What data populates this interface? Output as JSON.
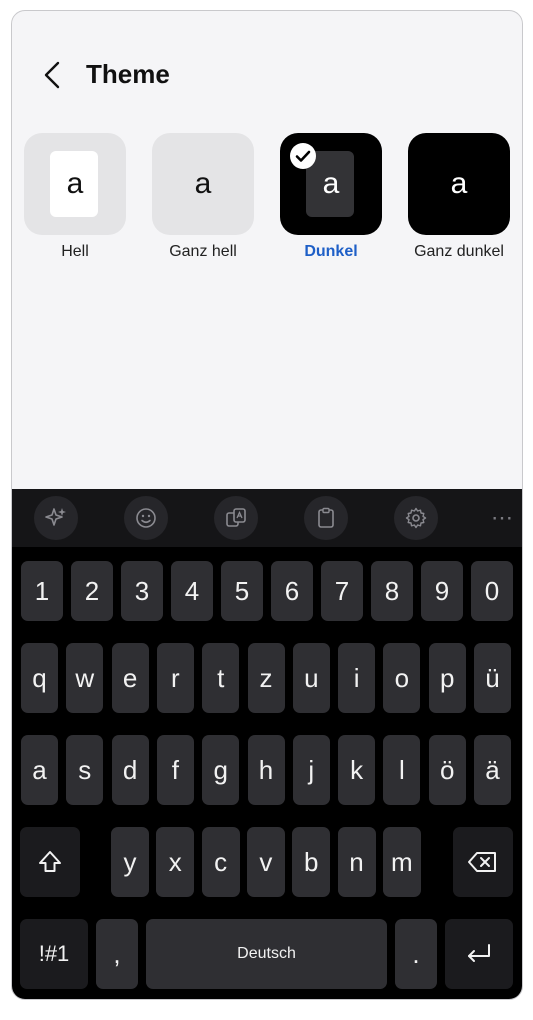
{
  "header": {
    "title": "Theme"
  },
  "themes": [
    {
      "letter": "a",
      "label": "Hell"
    },
    {
      "letter": "a",
      "label": "Ganz hell"
    },
    {
      "letter": "a",
      "label": "Dunkel",
      "selected": true
    },
    {
      "letter": "a",
      "label": "Ganz dunkel"
    }
  ],
  "colors": {
    "accent": "#1e5fc7",
    "key": "#2f2f33",
    "keyboard_bg": "#000000"
  },
  "toolbar": {
    "icons": [
      "sparkle-icon",
      "emoji-icon",
      "translate-icon",
      "clipboard-icon",
      "settings-icon",
      "more-icon"
    ]
  },
  "keyboard": {
    "numbers": [
      "1",
      "2",
      "3",
      "4",
      "5",
      "6",
      "7",
      "8",
      "9",
      "0"
    ],
    "row1": [
      "q",
      "w",
      "e",
      "r",
      "t",
      "z",
      "u",
      "i",
      "o",
      "p",
      "ü"
    ],
    "row2": [
      "a",
      "s",
      "d",
      "f",
      "g",
      "h",
      "j",
      "k",
      "l",
      "ö",
      "ä"
    ],
    "row3": [
      "y",
      "x",
      "c",
      "v",
      "b",
      "n",
      "m"
    ],
    "symbols_label": "!#1",
    "comma": ",",
    "space_label": "Deutsch",
    "period": "."
  }
}
